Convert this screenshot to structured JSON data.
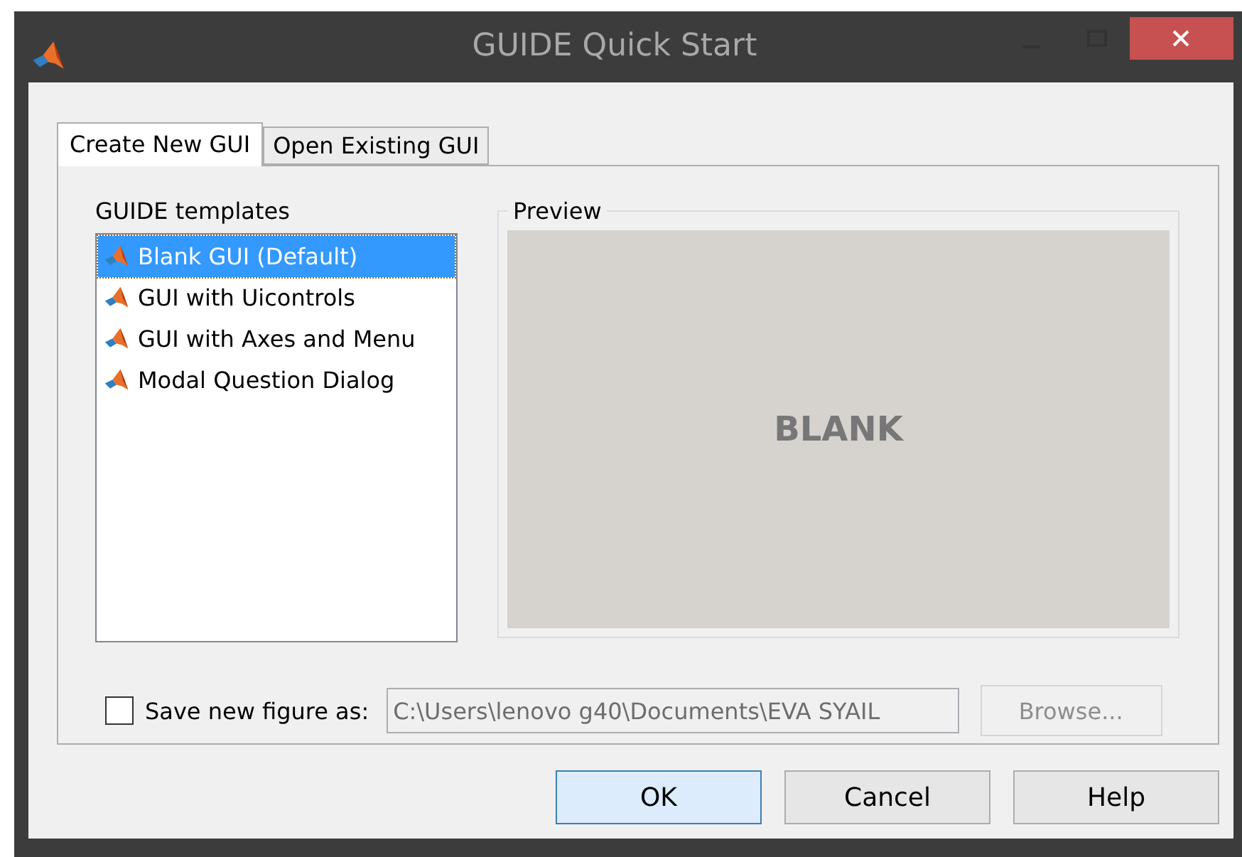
{
  "window": {
    "title": "GUIDE Quick Start"
  },
  "tabs": [
    {
      "label": "Create New GUI",
      "selected": true
    },
    {
      "label": "Open Existing GUI",
      "selected": false
    }
  ],
  "templates": {
    "label": "GUIDE templates",
    "items": [
      {
        "label": "Blank GUI (Default)",
        "selected": true
      },
      {
        "label": "GUI with Uicontrols",
        "selected": false
      },
      {
        "label": "GUI with Axes and Menu",
        "selected": false
      },
      {
        "label": "Modal Question Dialog",
        "selected": false
      }
    ]
  },
  "preview": {
    "label": "Preview",
    "text": "BLANK"
  },
  "save": {
    "checked": false,
    "label": "Save new figure as:",
    "value": "C:\\Users\\lenovo g40\\Documents\\EVA SYAIL",
    "browse": {
      "label": "Browse...",
      "disabled": true
    }
  },
  "buttons": [
    {
      "label": "OK",
      "focused": true
    },
    {
      "label": "Cancel",
      "focused": false
    },
    {
      "label": "Help",
      "focused": false
    }
  ]
}
